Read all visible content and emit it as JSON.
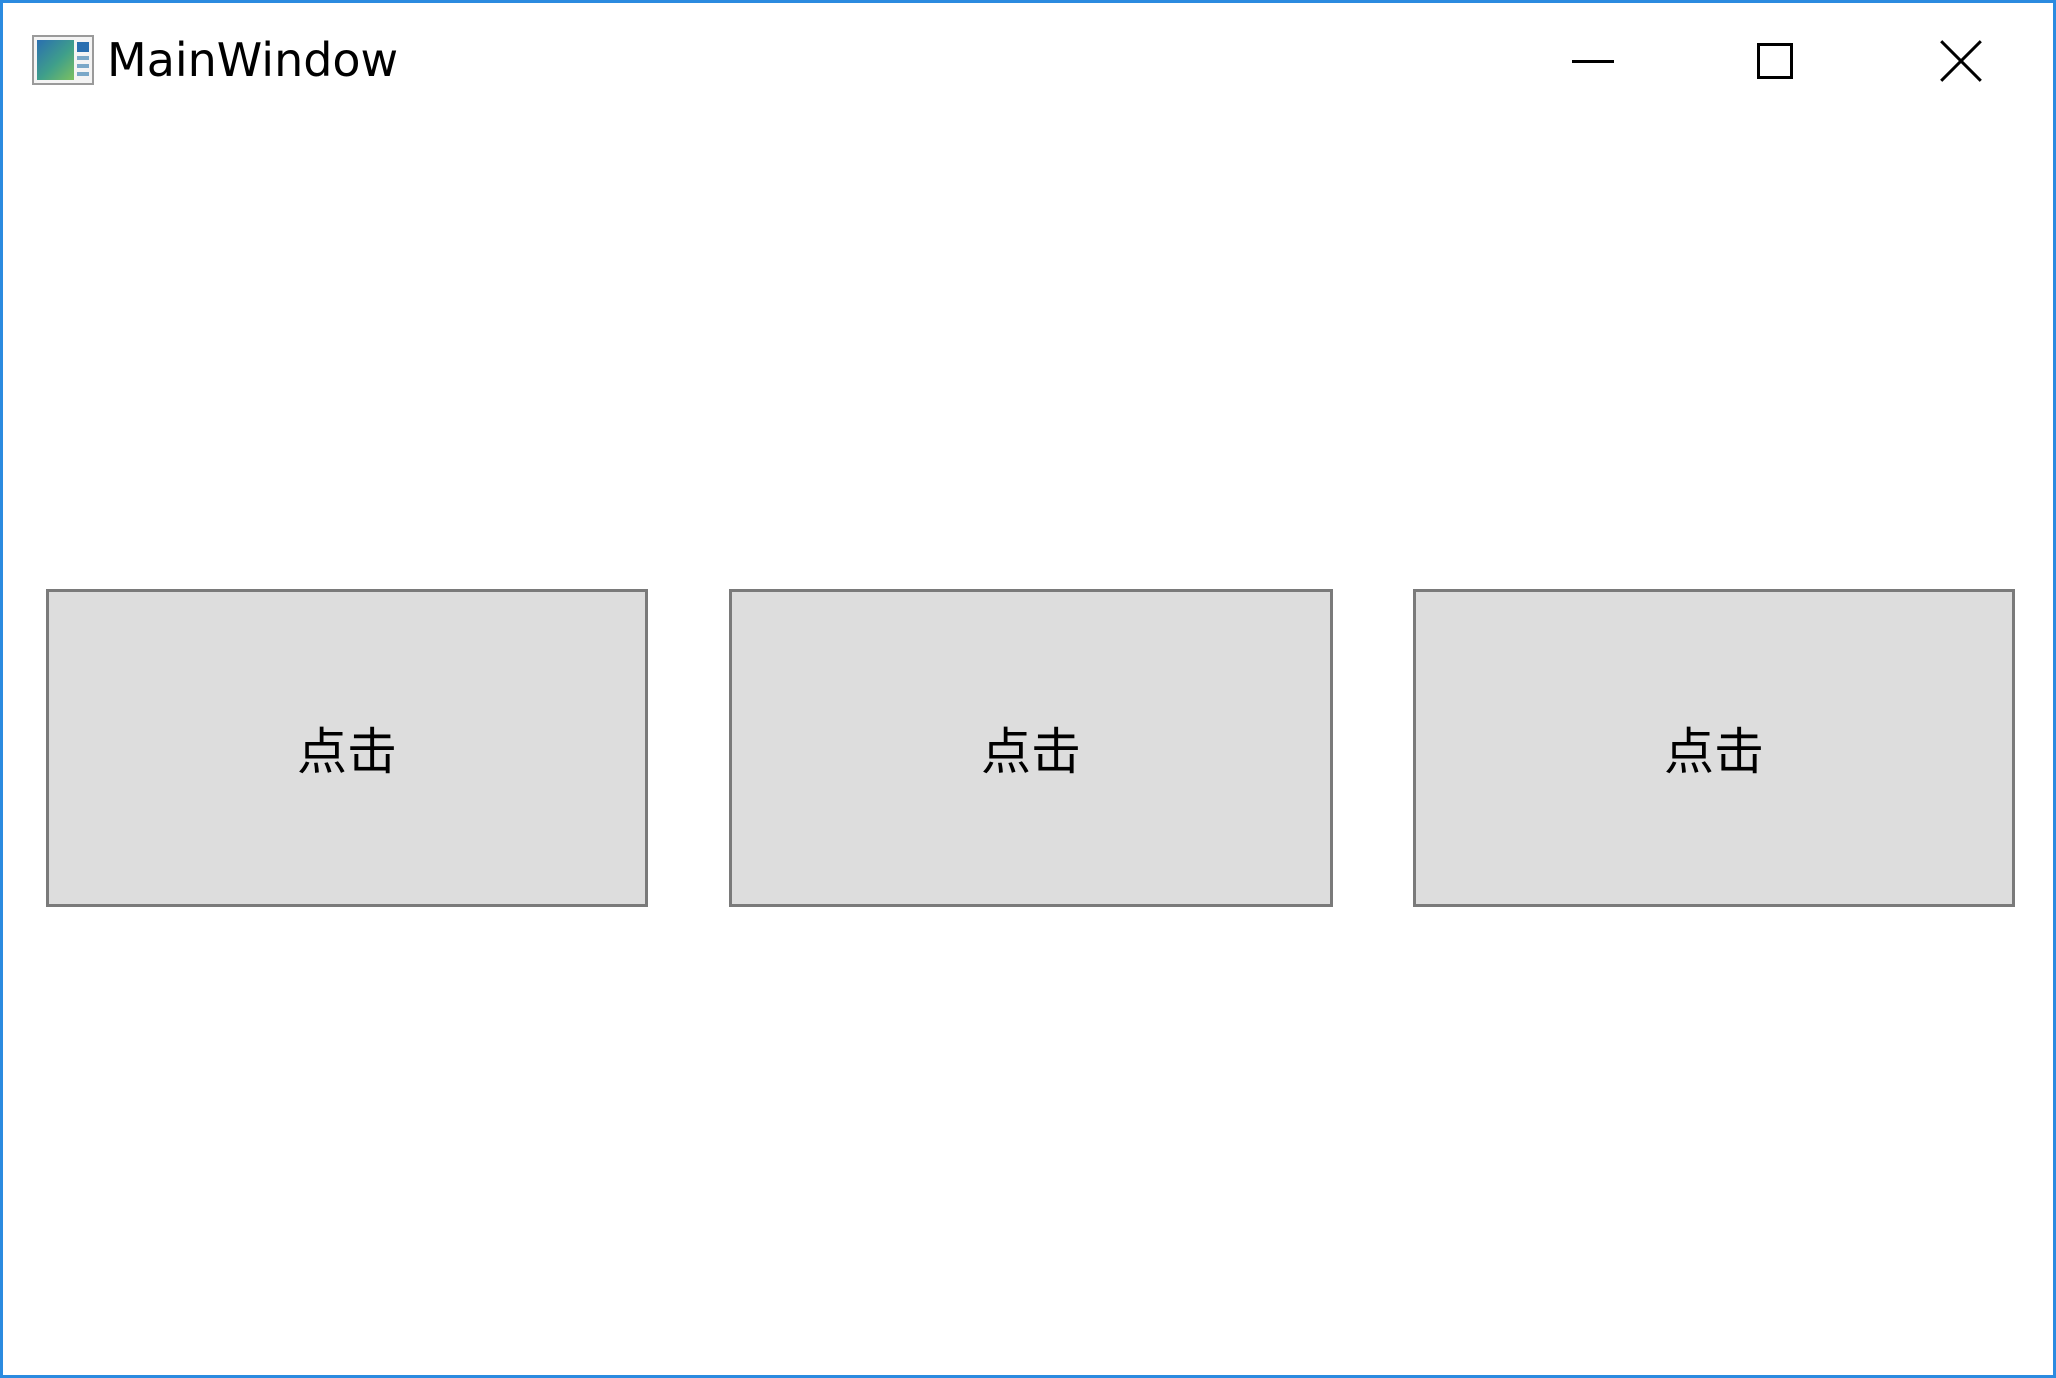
{
  "window": {
    "title": "MainWindow",
    "accent_color": "#2b8be0",
    "icon": "app-window-icon",
    "controls": {
      "minimize_icon": "minimize-icon",
      "maximize_icon": "maximize-icon",
      "close_icon": "close-icon"
    }
  },
  "content": {
    "buttons": [
      {
        "label": "点击"
      },
      {
        "label": "点击"
      },
      {
        "label": "点击"
      }
    ]
  }
}
